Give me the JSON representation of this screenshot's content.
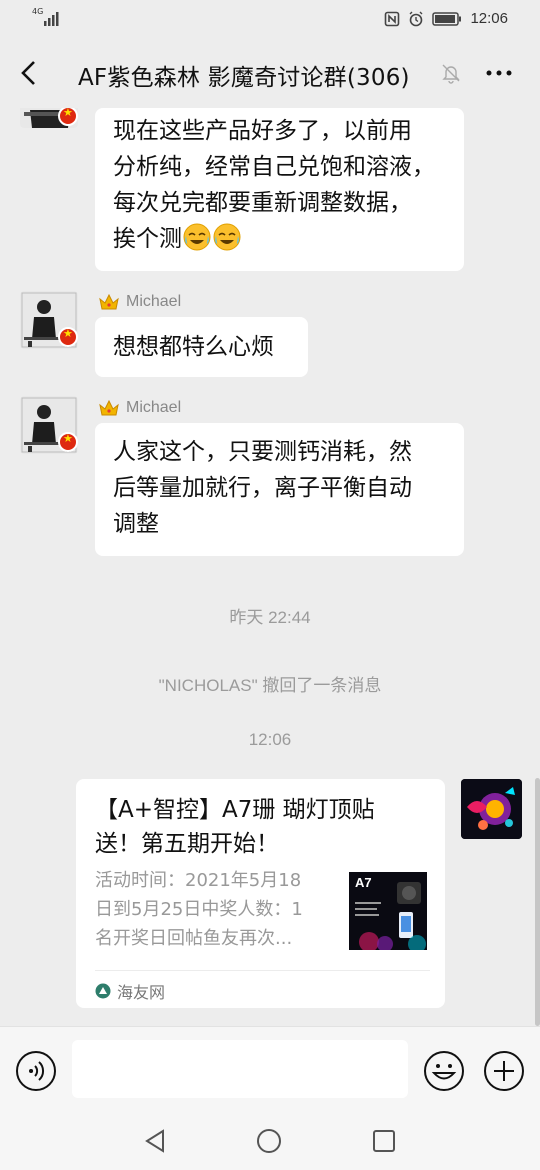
{
  "status_bar": {
    "network": "4G",
    "time": "12:06"
  },
  "header": {
    "back_icon": "chevron-left-icon",
    "title": "AF紫色森林 影魔奇讨论群(306)",
    "mute_icon": "bell-off-icon",
    "more_icon": "more-icon"
  },
  "messages": [
    {
      "sender": "",
      "text_lines": [
        "现在这些产品好多了，以前用",
        "分析纯，经常自己兑饱和溶液，",
        "每次兑完都要重新调整数据，",
        "挨个测"
      ],
      "emoji": "laugh-cry-emoji"
    },
    {
      "sender": "Michael",
      "text_lines": [
        "想想都特么心烦"
      ]
    },
    {
      "sender": "Michael",
      "text_lines": [
        "人家这个，只要测钙消耗，然",
        "后等量加就行，离子平衡自动",
        "调整"
      ]
    }
  ],
  "system": {
    "timestamp_1": "昨天 22:44",
    "recall_notice": "\"NICHOLAS\" 撤回了一条消息",
    "timestamp_2": "12:06"
  },
  "card": {
    "title_lines": [
      "【A+智控】A7珊 瑚灯顶贴",
      "送！第五期开始！"
    ],
    "desc_lines": [
      "活动时间：2021年5月18",
      "日到5月25日中奖人数：1",
      "名开奖日回帖鱼友再次..."
    ],
    "thumb_label": "A7",
    "source": "海友网"
  },
  "input": {
    "placeholder": ""
  },
  "colors": {
    "background": "#ededed",
    "bubble": "#ffffff",
    "flag": "#de2910"
  }
}
